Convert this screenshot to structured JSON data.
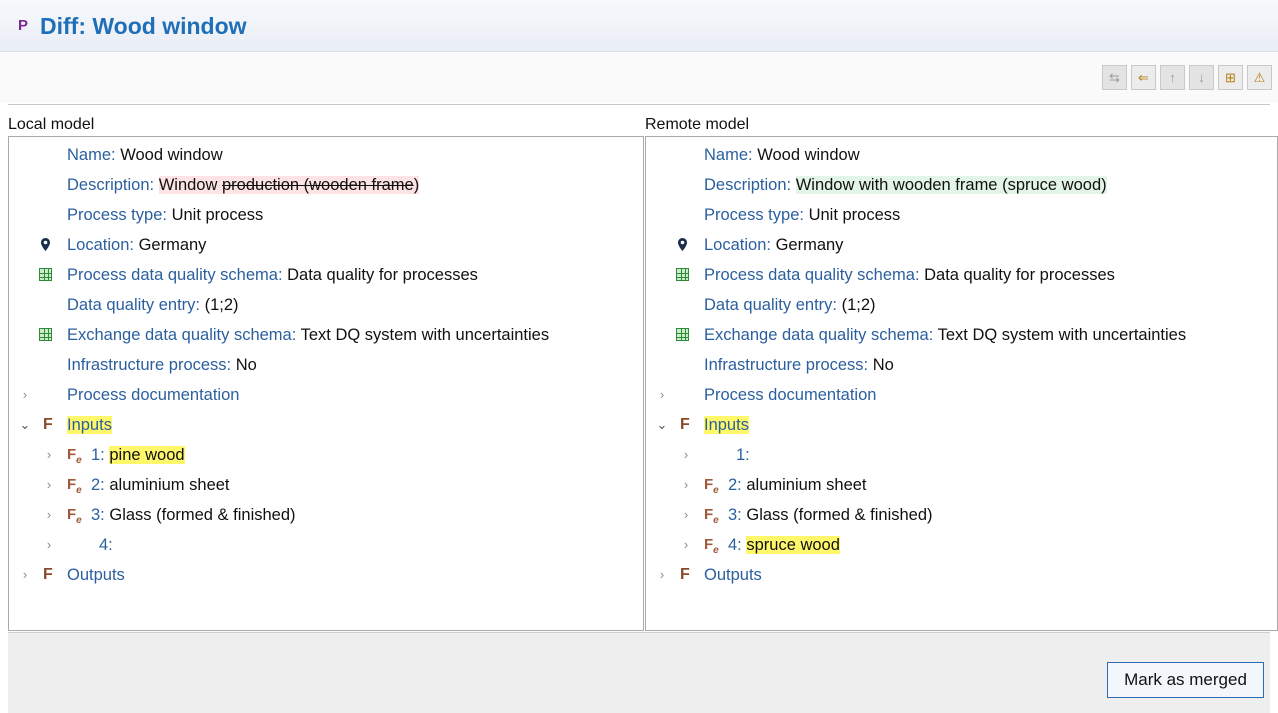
{
  "header": {
    "icon_glyph": "P",
    "title": "Diff: Wood window"
  },
  "toolbar": {
    "buttons": [
      {
        "name": "copy-to-local-icon",
        "glyph": "⇆",
        "enabled": false
      },
      {
        "name": "copy-left-icon",
        "glyph": "⇐",
        "enabled": true
      },
      {
        "name": "previous-diff-icon",
        "glyph": "↑",
        "enabled": false
      },
      {
        "name": "next-diff-icon",
        "glyph": "↓",
        "enabled": false
      },
      {
        "name": "expand-all-icon",
        "glyph": "⊞",
        "enabled": true
      },
      {
        "name": "warning-icon",
        "glyph": "⚠",
        "enabled": true
      }
    ]
  },
  "left": {
    "label": "Local model",
    "name_label": "Name:",
    "name_value": "Wood window",
    "desc_label": "Description:",
    "desc_value_kept": "Window ",
    "desc_value_removed": "production (wooden frame",
    "desc_value_tail": ")",
    "ptype_label": "Process type:",
    "ptype_value": "Unit process",
    "loc_label": "Location:",
    "loc_value": "Germany",
    "pdq_label": "Process data quality schema:",
    "pdq_value": "Data quality for processes",
    "dqe_label": "Data quality entry:",
    "dqe_value": "(1;2)",
    "edq_label": "Exchange data quality schema:",
    "edq_value": "Text DQ system with uncertainties",
    "infra_label": "Infrastructure process:",
    "infra_value": "No",
    "doc_label": "Process documentation",
    "inputs_label": "Inputs",
    "inputs": [
      {
        "num": "1:",
        "value": "pine wood",
        "highlight": true,
        "icon": true
      },
      {
        "num": "2:",
        "value": "aluminium sheet",
        "highlight": false,
        "icon": true
      },
      {
        "num": "3:",
        "value": "Glass (formed & finished)",
        "highlight": false,
        "icon": true
      },
      {
        "num": "4:",
        "value": "",
        "highlight": false,
        "icon": false
      }
    ],
    "outputs_label": "Outputs"
  },
  "right": {
    "label": "Remote model",
    "name_label": "Name:",
    "name_value": "Wood window",
    "desc_label": "Description:",
    "desc_value_kept": "Window ",
    "desc_value_added": "with wooden frame (spruce wood)",
    "ptype_label": "Process type:",
    "ptype_value": "Unit process",
    "loc_label": "Location:",
    "loc_value": "Germany",
    "pdq_label": "Process data quality schema:",
    "pdq_value": "Data quality for processes",
    "dqe_label": "Data quality entry:",
    "dqe_value": "(1;2)",
    "edq_label": "Exchange data quality schema:",
    "edq_value": "Text DQ system with uncertainties",
    "infra_label": "Infrastructure process:",
    "infra_value": "No",
    "doc_label": "Process documentation",
    "inputs_label": "Inputs",
    "inputs": [
      {
        "num": "1:",
        "value": "",
        "highlight": false,
        "icon": false
      },
      {
        "num": "2:",
        "value": "aluminium sheet",
        "highlight": false,
        "icon": true
      },
      {
        "num": "3:",
        "value": "Glass (formed & finished)",
        "highlight": false,
        "icon": true
      },
      {
        "num": "4:",
        "value": "spruce wood",
        "highlight": true,
        "icon": true
      }
    ],
    "outputs_label": "Outputs"
  },
  "footer": {
    "mark_merged_label": "Mark as merged"
  },
  "colors": {
    "label_blue": "#2b5f9e",
    "title_blue": "#1e6fb8",
    "removed_bg": "#fde3e3",
    "added_bg": "#e3f5e6",
    "highlight_yellow": "#fff86a"
  }
}
